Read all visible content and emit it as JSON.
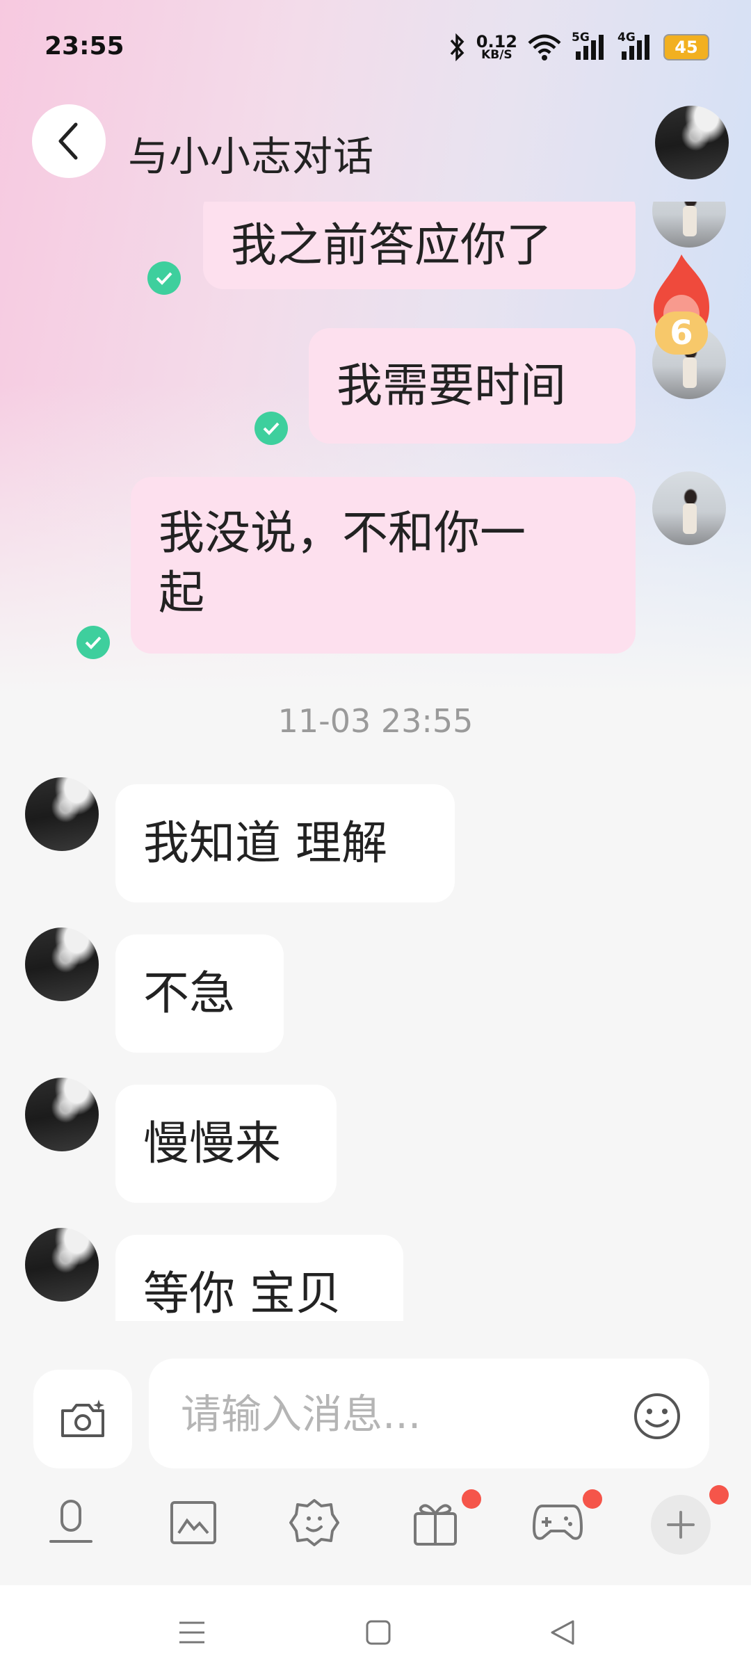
{
  "status_bar": {
    "time": "23:55",
    "net_speed_value": "0.12",
    "net_speed_unit": "KB/S",
    "sim1": "5G",
    "sim2": "4G",
    "battery": "45"
  },
  "header": {
    "title": "与小小志对话"
  },
  "messages": [
    {
      "direction": "out",
      "text": "我之前答应你了",
      "read": true
    },
    {
      "direction": "out",
      "text": "我需要时间",
      "read": true
    },
    {
      "direction": "out",
      "text_line1": "我没说，不和你一",
      "text_line2": "起",
      "read": true
    },
    {
      "direction": "in",
      "text": "我知道 理解"
    },
    {
      "direction": "in",
      "text": "不急"
    },
    {
      "direction": "in",
      "text": "慢慢来"
    },
    {
      "direction": "in",
      "text": "等你 宝贝"
    }
  ],
  "timestamp": "11-03 23:55",
  "streak_badge": "6",
  "composer": {
    "placeholder": "请输入消息..."
  },
  "toolbar": {
    "items": [
      "mic-icon",
      "image-icon",
      "sticker-icon",
      "gift-icon",
      "game-icon",
      "plus-icon"
    ]
  },
  "colors": {
    "outgoing_bubble": "#fde0ee",
    "incoming_bubble": "#ffffff",
    "read_check": "#3ecf9d",
    "badge_red": "#f5554a"
  }
}
